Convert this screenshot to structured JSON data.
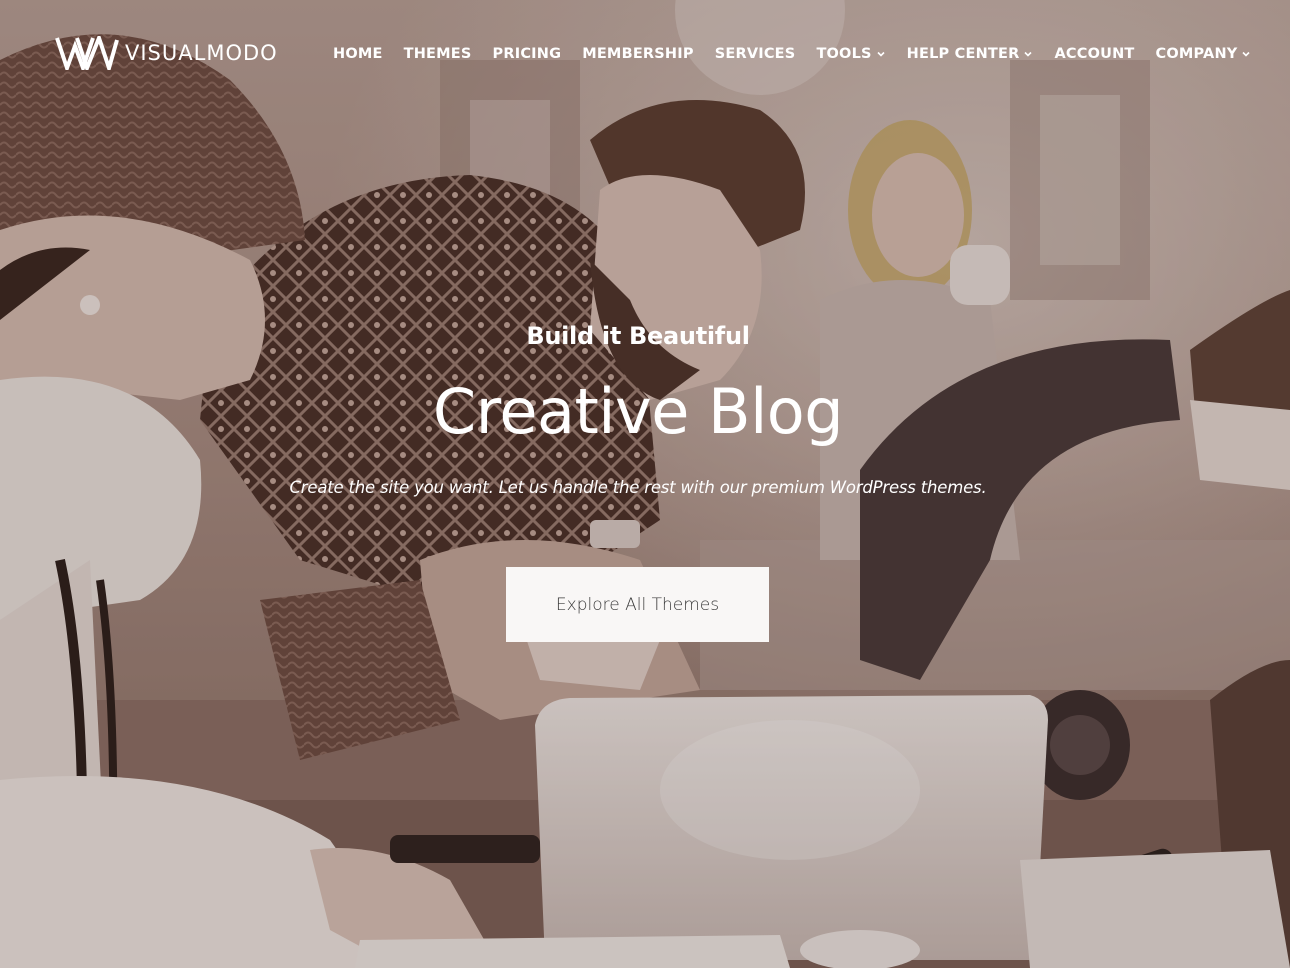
{
  "brand": {
    "name": "VISUALMODO"
  },
  "nav": {
    "items": [
      {
        "label": "HOME",
        "icon": ""
      },
      {
        "label": "THEMES",
        "icon": ""
      },
      {
        "label": "PRICING",
        "icon": ""
      },
      {
        "label": "MEMBERSHIP",
        "icon": ""
      },
      {
        "label": "SERVICES",
        "icon": ""
      },
      {
        "label": "TOOLS",
        "icon": "chevron-down-icon"
      },
      {
        "label": "HELP CENTER",
        "icon": "chevron-down-icon"
      },
      {
        "label": "ACCOUNT",
        "icon": ""
      },
      {
        "label": "COMPANY",
        "icon": "chevron-down-icon"
      }
    ]
  },
  "hero": {
    "eyebrow": "Build it Beautiful",
    "title": "Creative Blog",
    "subtitle": "Create the site you want. Let us handle the rest with our premium WordPress themes.",
    "cta_label": "Explore All Themes"
  },
  "colors": {
    "text": "#ffffff",
    "button_bg": "#f9f7f6",
    "button_text": "#3a3a3a",
    "photo_tint": "#7e655a"
  },
  "icons": {
    "logo": "visualmodo-logo-icon",
    "dropdown": "chevron-down-icon"
  }
}
